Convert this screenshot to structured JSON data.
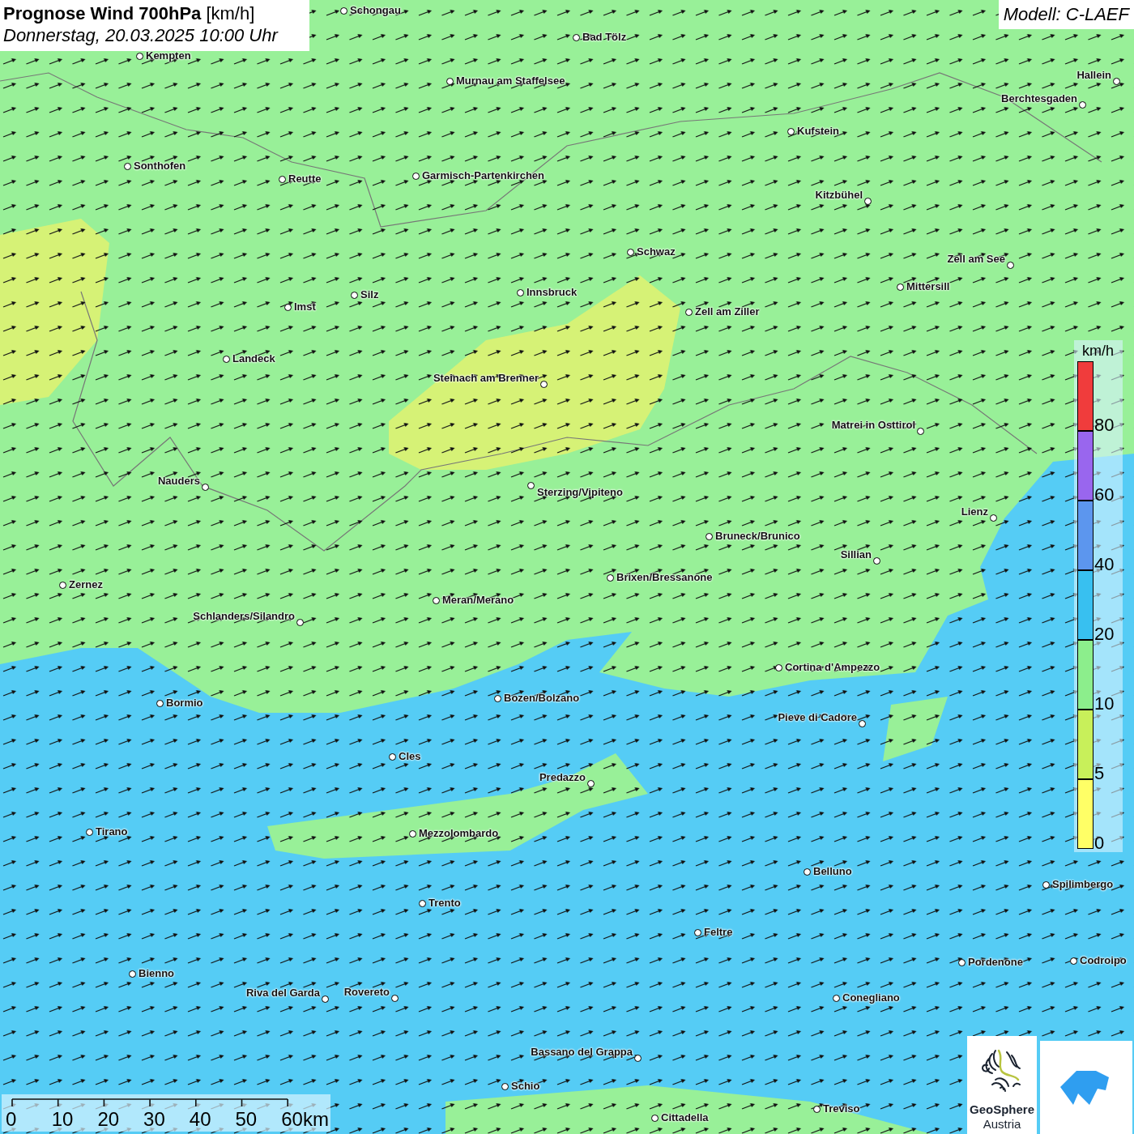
{
  "header": {
    "title": "Prognose Wind 700hPa",
    "unit": "[km/h]",
    "subtitle": "Donnerstag, 20.03.2025 10:00 Uhr"
  },
  "model": "Modell: C-LAEF",
  "cities": [
    {
      "name": "Schongau"
    },
    {
      "name": "Bad Tölz"
    },
    {
      "name": "Kempten"
    },
    {
      "name": "Murnau am Staffelsee"
    },
    {
      "name": "Hallein"
    },
    {
      "name": "Berchtesgaden"
    },
    {
      "name": "Kufstein"
    },
    {
      "name": "Sonthofen"
    },
    {
      "name": "Reutte"
    },
    {
      "name": "Garmisch-Partenkirchen"
    },
    {
      "name": "Kitzbühel"
    },
    {
      "name": "Schwaz"
    },
    {
      "name": "Zell am See"
    },
    {
      "name": "Mittersill"
    },
    {
      "name": "Innsbruck"
    },
    {
      "name": "Silz"
    },
    {
      "name": "Zell am Ziller"
    },
    {
      "name": "Imst"
    },
    {
      "name": "Landeck"
    },
    {
      "name": "Steinach am Brenner"
    },
    {
      "name": "Matrei in Osttirol"
    },
    {
      "name": "Nauders"
    },
    {
      "name": "Sterzing/Vipiteno"
    },
    {
      "name": "Lienz"
    },
    {
      "name": "Bruneck/Brunico"
    },
    {
      "name": "Sillian"
    },
    {
      "name": "Brixen/Bressanone"
    },
    {
      "name": "Zernez"
    },
    {
      "name": "Meran/Merano"
    },
    {
      "name": "Schlanders/Silandro"
    },
    {
      "name": "Cortina d'Ampezzo"
    },
    {
      "name": "Bozen/Bolzano"
    },
    {
      "name": "Bormio"
    },
    {
      "name": "Pieve di Cadore"
    },
    {
      "name": "Cles"
    },
    {
      "name": "Predazzo"
    },
    {
      "name": "Tirano"
    },
    {
      "name": "Mezzolombardo"
    },
    {
      "name": "Belluno"
    },
    {
      "name": "Spilimbergo"
    },
    {
      "name": "Trento"
    },
    {
      "name": "Feltre"
    },
    {
      "name": "Pordenone"
    },
    {
      "name": "Codroipo"
    },
    {
      "name": "Bienno"
    },
    {
      "name": "Riva del Garda"
    },
    {
      "name": "Rovereto"
    },
    {
      "name": "Conegliano"
    },
    {
      "name": "Bassano del Grappa"
    },
    {
      "name": "Schio"
    },
    {
      "name": "Treviso"
    },
    {
      "name": "Cittadella"
    }
  ],
  "legend": {
    "unit": "km/h",
    "bands": [
      {
        "color": "#f03c3c",
        "label": "80"
      },
      {
        "color": "#9966ee",
        "label": "60"
      },
      {
        "color": "#5c96ee",
        "label": "40"
      },
      {
        "color": "#38c0f0",
        "label": "20"
      },
      {
        "color": "#8cee8c",
        "label": "10"
      },
      {
        "color": "#c8f05a",
        "label": "5"
      },
      {
        "color": "#ffff66",
        "label": "0"
      }
    ]
  },
  "scale": [
    "0",
    "10",
    "20",
    "30",
    "40",
    "50",
    "60km"
  ],
  "logo": {
    "line1": "GeoSphere",
    "line2": "Austria"
  }
}
